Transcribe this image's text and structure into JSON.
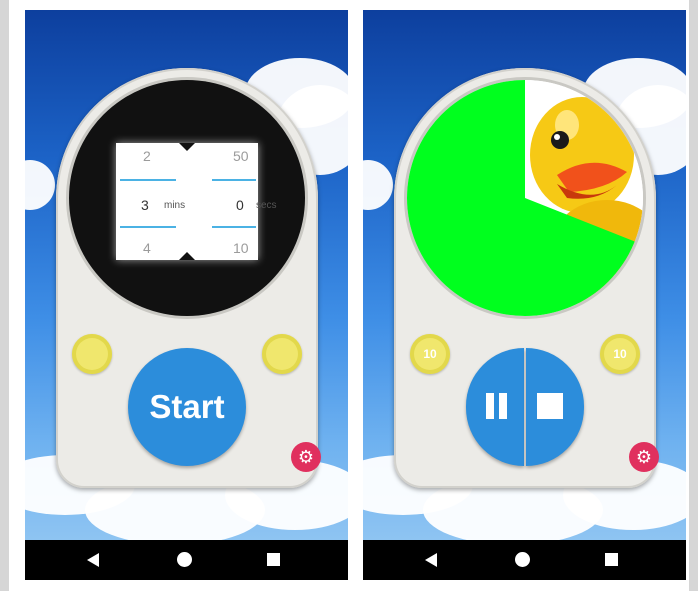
{
  "left_screen": {
    "picker": {
      "minutes": {
        "above": "2",
        "selected": "3",
        "below": "4",
        "unit": "mins"
      },
      "seconds": {
        "above": "50",
        "selected": "0",
        "below": "10",
        "unit": "secs"
      }
    },
    "start_label": "Start",
    "settings_icon": "gear-icon"
  },
  "right_screen": {
    "progress_remaining_fraction": 0.69,
    "side_left_label": "10",
    "side_right_label": "10",
    "pause_icon": "pause-icon",
    "stop_icon": "stop-icon",
    "settings_icon": "gear-icon"
  },
  "navbar": {
    "back_icon": "back-icon",
    "home_icon": "home-icon",
    "recents_icon": "recents-icon"
  },
  "colors": {
    "device": "#ecebe7",
    "accent_blue": "#2c8ddb",
    "side_button_yellow": "#f0e76d",
    "settings_red": "#e0305e",
    "progress_green": "#00ff1e",
    "picker_line": "#4bb2e4"
  }
}
